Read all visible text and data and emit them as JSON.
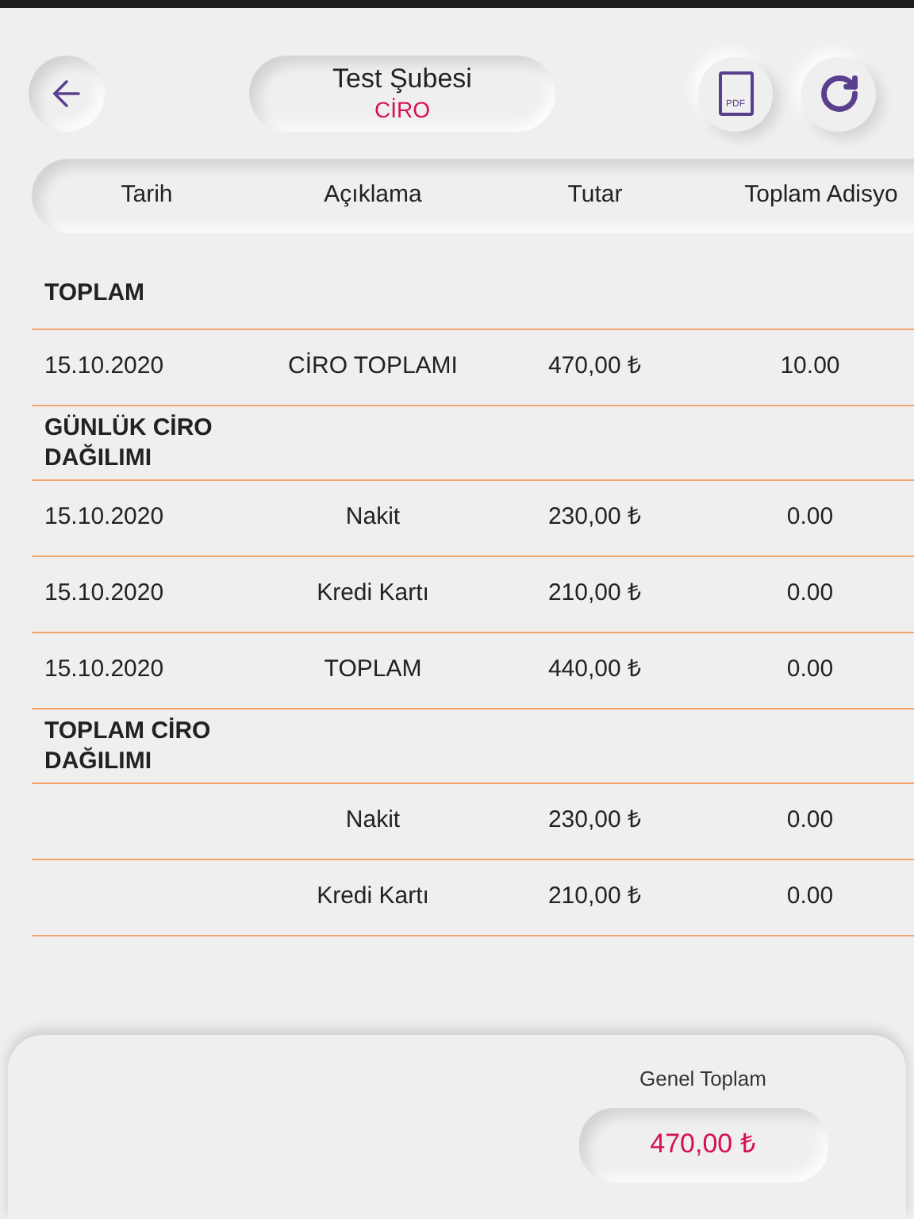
{
  "header": {
    "title": "Test Şubesi",
    "subtitle": "CİRO",
    "pdf_label": "PDF"
  },
  "table": {
    "columns": [
      "Tarih",
      "Açıklama",
      "Tutar",
      "Toplam Adisyo"
    ],
    "rows": [
      {
        "kind": "section",
        "label": "TOPLAM"
      },
      {
        "kind": "row",
        "cells": [
          "15.10.2020",
          "CİRO TOPLAMI",
          "470,00 ₺",
          "10.00"
        ]
      },
      {
        "kind": "section",
        "label": "GÜNLÜK CİRO DAĞILIMI"
      },
      {
        "kind": "row",
        "cells": [
          "15.10.2020",
          "Nakit",
          "230,00 ₺",
          "0.00"
        ]
      },
      {
        "kind": "row",
        "cells": [
          "15.10.2020",
          "Kredi Kartı",
          "210,00 ₺",
          "0.00"
        ]
      },
      {
        "kind": "row",
        "cells": [
          "15.10.2020",
          "TOPLAM",
          "440,00 ₺",
          "0.00"
        ]
      },
      {
        "kind": "section",
        "label": "TOPLAM CİRO DAĞILIMI"
      },
      {
        "kind": "row",
        "cells": [
          "",
          "Nakit",
          "230,00 ₺",
          "0.00"
        ]
      },
      {
        "kind": "row",
        "cells": [
          "",
          "Kredi Kartı",
          "210,00 ₺",
          "0.00"
        ]
      }
    ]
  },
  "footer": {
    "label": "Genel Toplam",
    "total": "470,00 ₺"
  }
}
